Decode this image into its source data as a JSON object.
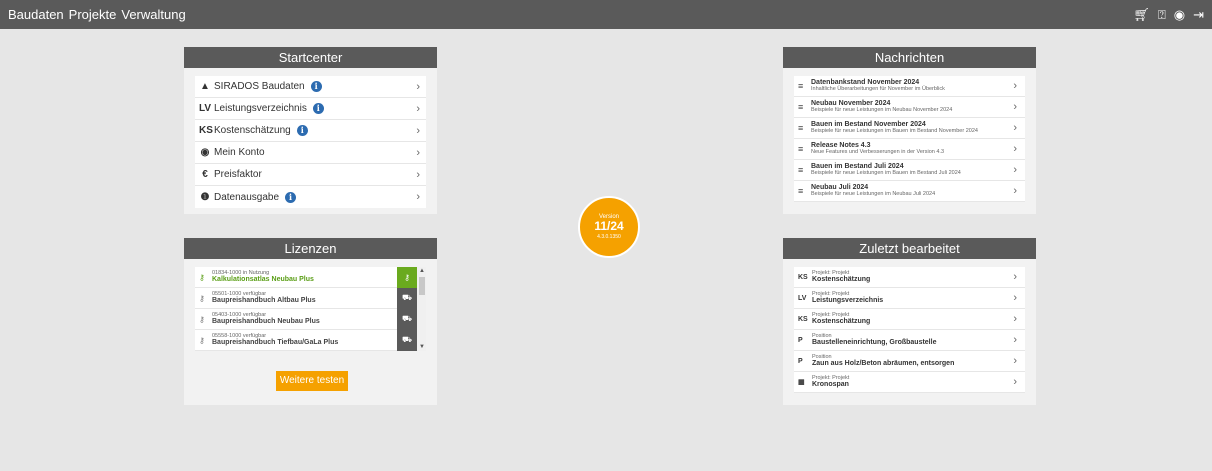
{
  "topbar": {
    "nav": [
      "Baudaten",
      "Projekte",
      "Verwaltung"
    ],
    "icons": [
      "cart-icon",
      "help-icon",
      "user-icon",
      "logout-icon"
    ]
  },
  "startcenter": {
    "title": "Startcenter",
    "items": [
      {
        "icon": "triangle-icon",
        "glyph": "▲",
        "label": "SIRADOS Baudaten",
        "info": true
      },
      {
        "icon": "lv-icon",
        "glyph": "LV",
        "label": "Leistungsverzeichnis",
        "info": true
      },
      {
        "icon": "ks-icon",
        "glyph": "KS",
        "label": "Kostenschätzung",
        "info": true
      },
      {
        "icon": "account-icon",
        "glyph": "◉",
        "label": "Mein Konto",
        "info": false
      },
      {
        "icon": "euro-icon",
        "glyph": "€",
        "label": "Preisfaktor",
        "info": false
      },
      {
        "icon": "output-icon",
        "glyph": "❶",
        "label": "Datenausgabe",
        "info": true
      }
    ]
  },
  "lizenzen": {
    "title": "Lizenzen",
    "items": [
      {
        "code": "01834-1000 in Nutzung",
        "name": "Kalkulationsatlas Neubau Plus",
        "active": true
      },
      {
        "code": "05501-1000 verfügbar",
        "name": "Baupreishandbuch Altbau Plus",
        "active": false
      },
      {
        "code": "05403-1000 verfügbar",
        "name": "Baupreishandbuch Neubau Plus",
        "active": false
      },
      {
        "code": "05558-1000 verfügbar",
        "name": "Baupreishandbuch Tiefbau/GaLa Plus",
        "active": false
      }
    ],
    "button": "Weitere testen"
  },
  "version": {
    "label": "Version",
    "number": "11/24",
    "build": "4.3.0.1350"
  },
  "nachrichten": {
    "title": "Nachrichten",
    "items": [
      {
        "title": "Datenbankstand November 2024",
        "sub": "Inhaltliche Überarbeitungen für November im Überblick"
      },
      {
        "title": "Neubau November 2024",
        "sub": "Beispiele für neue Leistungen im Neubau November 2024"
      },
      {
        "title": "Bauen im Bestand November 2024",
        "sub": "Beispiele für neue Leistungen im Bauen im Bestand November 2024"
      },
      {
        "title": "Release Notes 4.3",
        "sub": "Neue Features und Verbesserungen in der Version 4.3"
      },
      {
        "title": "Bauen im Bestand Juli 2024",
        "sub": "Beispiele für neue Leistungen im Bauen im Bestand Juli 2024"
      },
      {
        "title": "Neubau Juli 2024",
        "sub": "Beispiele für neue Leistungen im Neubau Juli 2024"
      }
    ]
  },
  "zuletzt": {
    "title": "Zuletzt bearbeitet",
    "items": [
      {
        "glyph": "KS",
        "top": "Projekt: Projekt",
        "name": "Kostenschätzung"
      },
      {
        "glyph": "LV",
        "top": "Projekt: Projekt",
        "name": "Leistungsverzeichnis"
      },
      {
        "glyph": "KS",
        "top": "Projekt: Projekt",
        "name": "Kostenschätzung"
      },
      {
        "glyph": "P",
        "top": "Position",
        "name": "Baustelleneinrichtung, Großbaustelle"
      },
      {
        "glyph": "P",
        "top": "Position",
        "name": "Zaun aus Holz/Beton abräumen, entsorgen"
      },
      {
        "glyph": "▦",
        "top": "Projekt: Projekt",
        "name": "Kronospan"
      }
    ]
  }
}
